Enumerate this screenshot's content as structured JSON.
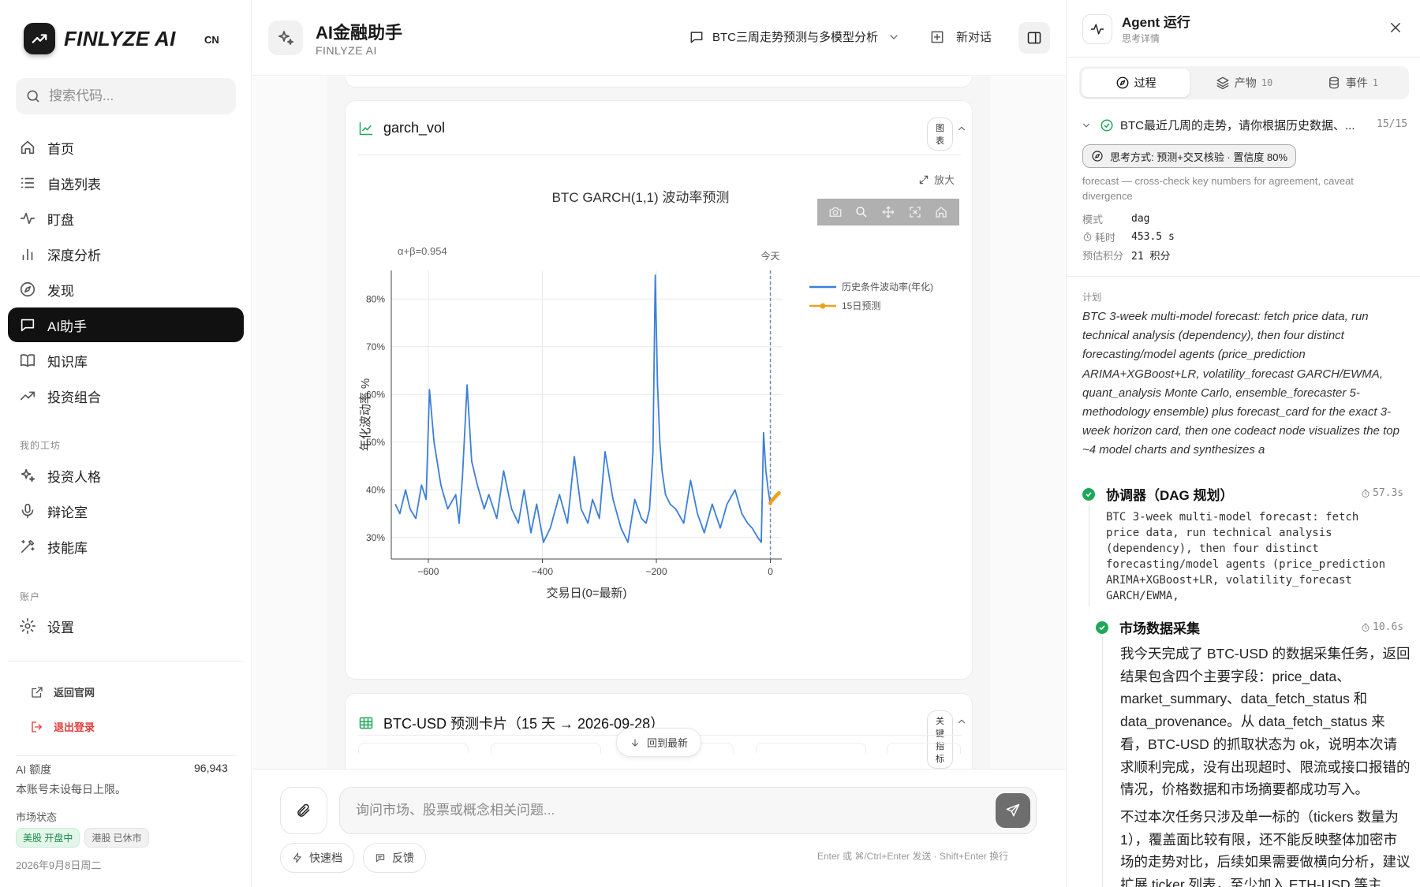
{
  "app": {
    "brand": "FINLYZE AI",
    "lang": "CN"
  },
  "sidebar": {
    "search_placeholder": "搜索代码...",
    "items": [
      {
        "label": "首页",
        "icon": "home-icon"
      },
      {
        "label": "自选列表",
        "icon": "list-icon"
      },
      {
        "label": "盯盘",
        "icon": "pulse-icon"
      },
      {
        "label": "深度分析",
        "icon": "bar-chart-icon"
      },
      {
        "label": "发现",
        "icon": "compass-icon"
      },
      {
        "label": "AI助手",
        "icon": "chat-icon",
        "active": true
      },
      {
        "label": "知识库",
        "icon": "book-icon"
      },
      {
        "label": "投资组合",
        "icon": "trend-icon"
      }
    ],
    "workshop_label": "我的工坊",
    "workshop_items": [
      {
        "label": "投资人格",
        "icon": "sparkle-icon"
      },
      {
        "label": "辩论室",
        "icon": "mic-icon"
      },
      {
        "label": "技能库",
        "icon": "wand-icon"
      }
    ],
    "account_label": "账户",
    "settings_label": "设置",
    "back_to_site": "返回官网",
    "logout": "退出登录",
    "quota_label": "AI 额度",
    "quota_value": "96,943",
    "quota_note": "本账号未设每日上限。",
    "market_label": "市场状态",
    "market_us": "美股 开盘中",
    "market_hk": "港股 已休市",
    "date": "2026年9月8日周二"
  },
  "header": {
    "title": "AI金融助手",
    "subtitle": "FINLYZE AI",
    "conversation": "BTC三周走势预测与多模型分析",
    "new_chat": "新对话"
  },
  "main": {
    "card_chart": {
      "name": "garch_vol",
      "badge": "图表",
      "zoom": "放大"
    },
    "card_forecast": {
      "title": "BTC-USD 预测卡片（15 天 → 2026-09-28）",
      "badge": "关键指标"
    },
    "jump_latest": "回到最新"
  },
  "chart_data": {
    "type": "line",
    "title": "BTC GARCH(1,1) 波动率预测",
    "xlabel": "交易日(0=最新)",
    "ylabel": "年化波动率 %",
    "annotation_left": "α+β=0.954",
    "annotation_today": "今天",
    "xlim": [
      -665,
      20
    ],
    "ylim": [
      25.5,
      86
    ],
    "xticks": [
      -600,
      -400,
      -200,
      0
    ],
    "xtick_labels": [
      "−600",
      "−400",
      "−200",
      "0"
    ],
    "yticks": [
      30,
      40,
      50,
      60,
      70,
      80
    ],
    "ytick_labels": [
      "30%",
      "40%",
      "50%",
      "60%",
      "70%",
      "80%"
    ],
    "legend_position": "top-right",
    "colors": {
      "history": "#3c7fd8",
      "forecast": "#f0a020",
      "today_line": "#6a8bb8"
    },
    "series": [
      {
        "name": "历史条件波动率(年化)",
        "x": [
          -658,
          -650,
          -640,
          -632,
          -622,
          -612,
          -604,
          -598,
          -590,
          -578,
          -566,
          -552,
          -546,
          -540,
          -532,
          -524,
          -514,
          -502,
          -494,
          -480,
          -468,
          -454,
          -442,
          -432,
          -420,
          -410,
          -398,
          -386,
          -370,
          -356,
          -344,
          -332,
          -320,
          -312,
          -300,
          -290,
          -276,
          -262,
          -250,
          -238,
          -226,
          -218,
          -212,
          -206,
          -202,
          -198,
          -194,
          -190,
          -184,
          -176,
          -166,
          -152,
          -140,
          -128,
          -116,
          -102,
          -88,
          -76,
          -62,
          -50,
          -40,
          -32,
          -22,
          -16,
          -12,
          -8,
          -4,
          0
        ],
        "values": [
          37,
          35,
          40,
          36,
          34,
          41,
          38,
          61,
          50,
          41,
          36,
          39,
          33,
          43,
          62,
          46,
          41,
          36,
          39,
          34,
          44,
          36,
          33,
          40,
          31,
          37,
          29,
          32,
          39,
          33,
          47,
          36,
          33,
          38,
          34,
          48,
          38,
          32,
          29,
          38,
          34,
          33,
          36,
          48,
          85,
          62,
          50,
          44,
          39,
          37,
          36,
          33,
          42,
          35,
          31,
          37,
          32,
          37,
          40,
          35,
          33,
          32,
          30,
          29,
          52,
          44,
          40,
          37
        ]
      },
      {
        "name": "15日预测",
        "x": [
          0,
          3,
          6,
          9,
          12,
          15
        ],
        "values": [
          37.2,
          37.8,
          38.2,
          38.6,
          39.0,
          39.3
        ]
      }
    ]
  },
  "composer": {
    "placeholder": "询问市场、股票或概念相关问题...",
    "quick": "快速档",
    "feedback": "反馈",
    "hint": "Enter 或 ⌘/Ctrl+Enter 发送 · Shift+Enter 换行"
  },
  "agent": {
    "title": "Agent 运行",
    "subtitle": "思考详情",
    "tabs": [
      {
        "label": "过程",
        "count": ""
      },
      {
        "label": "产物",
        "count": "10"
      },
      {
        "label": "事件",
        "count": "1"
      }
    ],
    "question": "BTC最近几周的走势，请你根据历史数据、...",
    "progress": "15/15",
    "mode_pill": "思考方式: 预测+交叉核验 · 置信度 80%",
    "forecast_note": "forecast — cross-check key numbers for agreement, caveat divergence",
    "kv": [
      {
        "k": "模式",
        "v": "dag"
      },
      {
        "k": "耗时",
        "v": "453.5 s"
      },
      {
        "k": "预估积分",
        "v": "21 积分"
      }
    ],
    "plan_label": "计划",
    "plan_text": "BTC 3-week multi-model forecast: fetch price data, run technical analysis (dependency), then four distinct forecasting/model agents (price_prediction ARIMA+XGBoost+LR, volatility_forecast GARCH/EWMA, quant_analysis Monte Carlo, ensemble_forecaster 5-methodology ensemble) plus forecast_card for the exact 3-week horizon card, then one codeact node visualizes the top ~4 model charts and synthesizes a",
    "step1_title": "协调器（DAG 规划）",
    "step1_time": "57.3s",
    "step1_text": "BTC 3-week multi-model forecast: fetch\nprice data, run technical analysis\n(dependency), then four distinct\nforecasting/model agents (price_prediction\nARIMA+XGBoost+LR, volatility_forecast\nGARCH/EWMA,",
    "step2_title": "市场数据采集",
    "step2_time": "10.6s",
    "step2_p1": "我今天完成了 BTC-USD 的数据采集任务，返回结果包含四个主要字段：price_data、market_summary、data_fetch_status 和 data_provenance。从 data_fetch_status 来看，BTC-USD 的抓取状态为 ok，说明本次请求顺利完成，没有出现超时、限流或接口报错的情况，价格数据和市场摘要都成功写入。",
    "step2_p2": "不过本次任务只涉及单一标的（tickers 数量为 1），覆盖面比较有限，还不能反映整体加密市场的走势对比，后续如果需要做横向分析，建议扩展 ticker 列表，至少加入 ETH-USD 等主"
  }
}
